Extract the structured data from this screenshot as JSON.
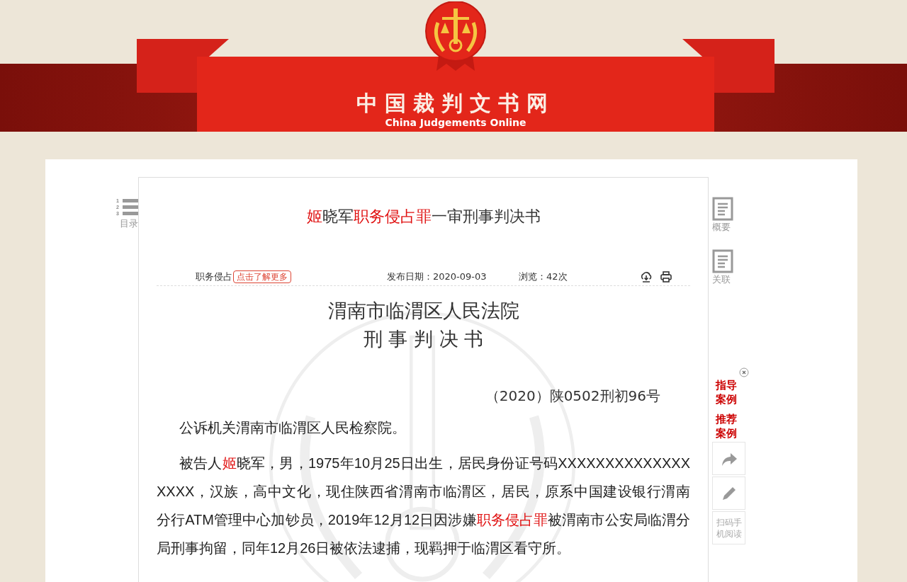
{
  "header": {
    "site_name": "中国裁判文书网",
    "site_name_en": "China Judgements Online"
  },
  "left_nav": {
    "toc_label": "目录",
    "toc_numbers": [
      "1",
      "2",
      "3"
    ]
  },
  "document": {
    "title": [
      {
        "text": "姬",
        "highlight": true
      },
      {
        "text": "晓军",
        "highlight": false
      },
      {
        "text": "职务侵占罪",
        "highlight": true
      },
      {
        "text": "一审刑事判决书",
        "highlight": false
      }
    ],
    "meta": {
      "cause": "职务侵占",
      "cause_link": "点击了解更多",
      "publish_date": "发布日期：2020-09-03",
      "views": "浏览：42次"
    },
    "court": "渭南市临渭区人民法院",
    "doc_type": "刑 事 判 决 书",
    "case_number": "（2020）陕0502刑初96号",
    "paragraphs": [
      [
        {
          "text": "公诉机关渭南市临渭区人民检察院。",
          "highlight": false
        }
      ],
      [
        {
          "text": "被告人",
          "highlight": false
        },
        {
          "text": "姬",
          "highlight": true
        },
        {
          "text": "晓军，男，1975年10月25日出生，居民身份证号码XXXXXXXXXXXXXXXXXX，汉族，高中文化，现住陕西省渭南市临渭区，居民，原系中国建设银行渭南分行ATM管理中心加钞员，2019年12月12日因涉嫌",
          "highlight": false
        },
        {
          "text": "职务侵占罪",
          "highlight": true
        },
        {
          "text": "被渭南市公安局临渭分局刑事拘留，同年12月26日被依法逮捕，现羁押于临渭区看守所。",
          "highlight": false
        }
      ]
    ]
  },
  "right_nav": {
    "items": [
      "概要",
      "关联"
    ],
    "promo": [
      "指导案例",
      "推荐案例"
    ],
    "tools": [
      {
        "kind": "share"
      },
      {
        "kind": "edit"
      },
      {
        "kind": "text",
        "label": "扫码手机阅读"
      }
    ]
  }
}
